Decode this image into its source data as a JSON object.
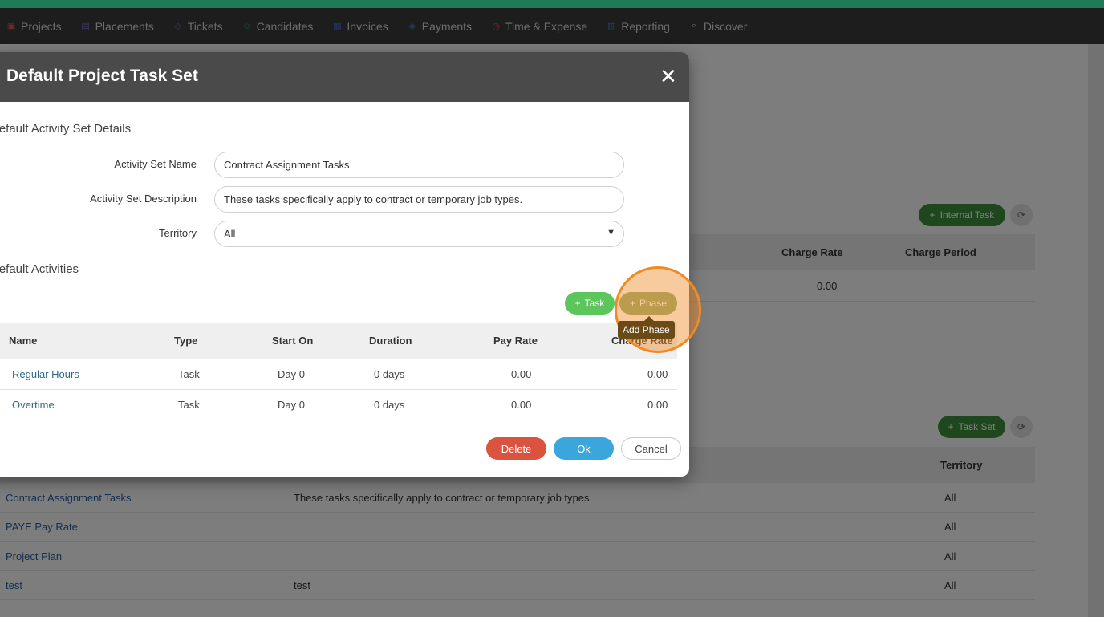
{
  "nav": {
    "items": [
      {
        "label": "Projects",
        "icon": "projects-icon",
        "glyph": "▣",
        "color": "#e05050"
      },
      {
        "label": "Placements",
        "icon": "placements-icon",
        "glyph": "▤",
        "color": "#7b6fd6"
      },
      {
        "label": "Tickets",
        "icon": "tickets-icon",
        "glyph": "◇",
        "color": "#5a7fd6"
      },
      {
        "label": "Candidates",
        "icon": "candidates-icon",
        "glyph": "☺",
        "color": "#3aa76d"
      },
      {
        "label": "Invoices",
        "icon": "invoices-icon",
        "glyph": "▦",
        "color": "#4a6fd6"
      },
      {
        "label": "Payments",
        "icon": "payments-icon",
        "glyph": "◈",
        "color": "#4a7fd6"
      },
      {
        "label": "Time & Expense",
        "icon": "clock-icon",
        "glyph": "◷",
        "color": "#e05050"
      },
      {
        "label": "Reporting",
        "icon": "bar-chart-icon",
        "glyph": "▥",
        "color": "#4a7fd6"
      },
      {
        "label": "Discover",
        "icon": "search-icon",
        "glyph": "⌕",
        "color": "#d8d8d8"
      }
    ]
  },
  "background": {
    "internal_task_button": "Internal Task",
    "task_set_button": "Task Set",
    "task_table": {
      "headers": [
        "Charge Rate",
        "Charge Period"
      ],
      "row_value": "0.00"
    },
    "task_set_table": {
      "header_territory": "Territory",
      "rows": [
        {
          "name": "Contract Assignment Tasks",
          "description": "These tasks specifically apply to contract or temporary job types.",
          "territory": "All"
        },
        {
          "name": "PAYE Pay Rate",
          "description": "",
          "territory": "All"
        },
        {
          "name": "Project Plan",
          "description": "",
          "territory": "All"
        },
        {
          "name": "test",
          "description": "test",
          "territory": "All"
        }
      ]
    }
  },
  "modal": {
    "title": "Default Project Task Set",
    "close_glyph": "✕",
    "details_section": "Default Activity Set Details",
    "activity_set_name_label": "Activity Set Name",
    "activity_set_name_value": "Contract Assignment Tasks",
    "activity_set_description_label": "Activity Set Description",
    "activity_set_description_value": "These tasks specifically apply to contract or temporary job types.",
    "territory_label": "Territory",
    "territory_value": "All",
    "activities_section": "Default Activities",
    "task_button": "Task",
    "phase_button": "Phase",
    "tooltip": "Add Phase",
    "table": {
      "headers": {
        "name": "Name",
        "type": "Type",
        "start_on": "Start On",
        "duration": "Duration",
        "pay_rate": "Pay Rate",
        "charge_rate": "Charge Rate"
      },
      "rows": [
        {
          "name": "Regular Hours",
          "type": "Task",
          "start_on": "Day 0",
          "duration": "0 days",
          "pay_rate": "0.00",
          "charge_rate": "0.00"
        },
        {
          "name": "Overtime",
          "type": "Task",
          "start_on": "Day 0",
          "duration": "0 days",
          "pay_rate": "0.00",
          "charge_rate": "0.00"
        }
      ]
    },
    "delete_button": "Delete",
    "ok_button": "Ok",
    "cancel_button": "Cancel"
  },
  "colors": {
    "accent": "#1f7a5a",
    "nav_bg": "#3a3a3a",
    "task_button": "#5cc55c",
    "delete": "#d9533f",
    "ok": "#3aa6dc",
    "highlight": "#f08a24"
  }
}
